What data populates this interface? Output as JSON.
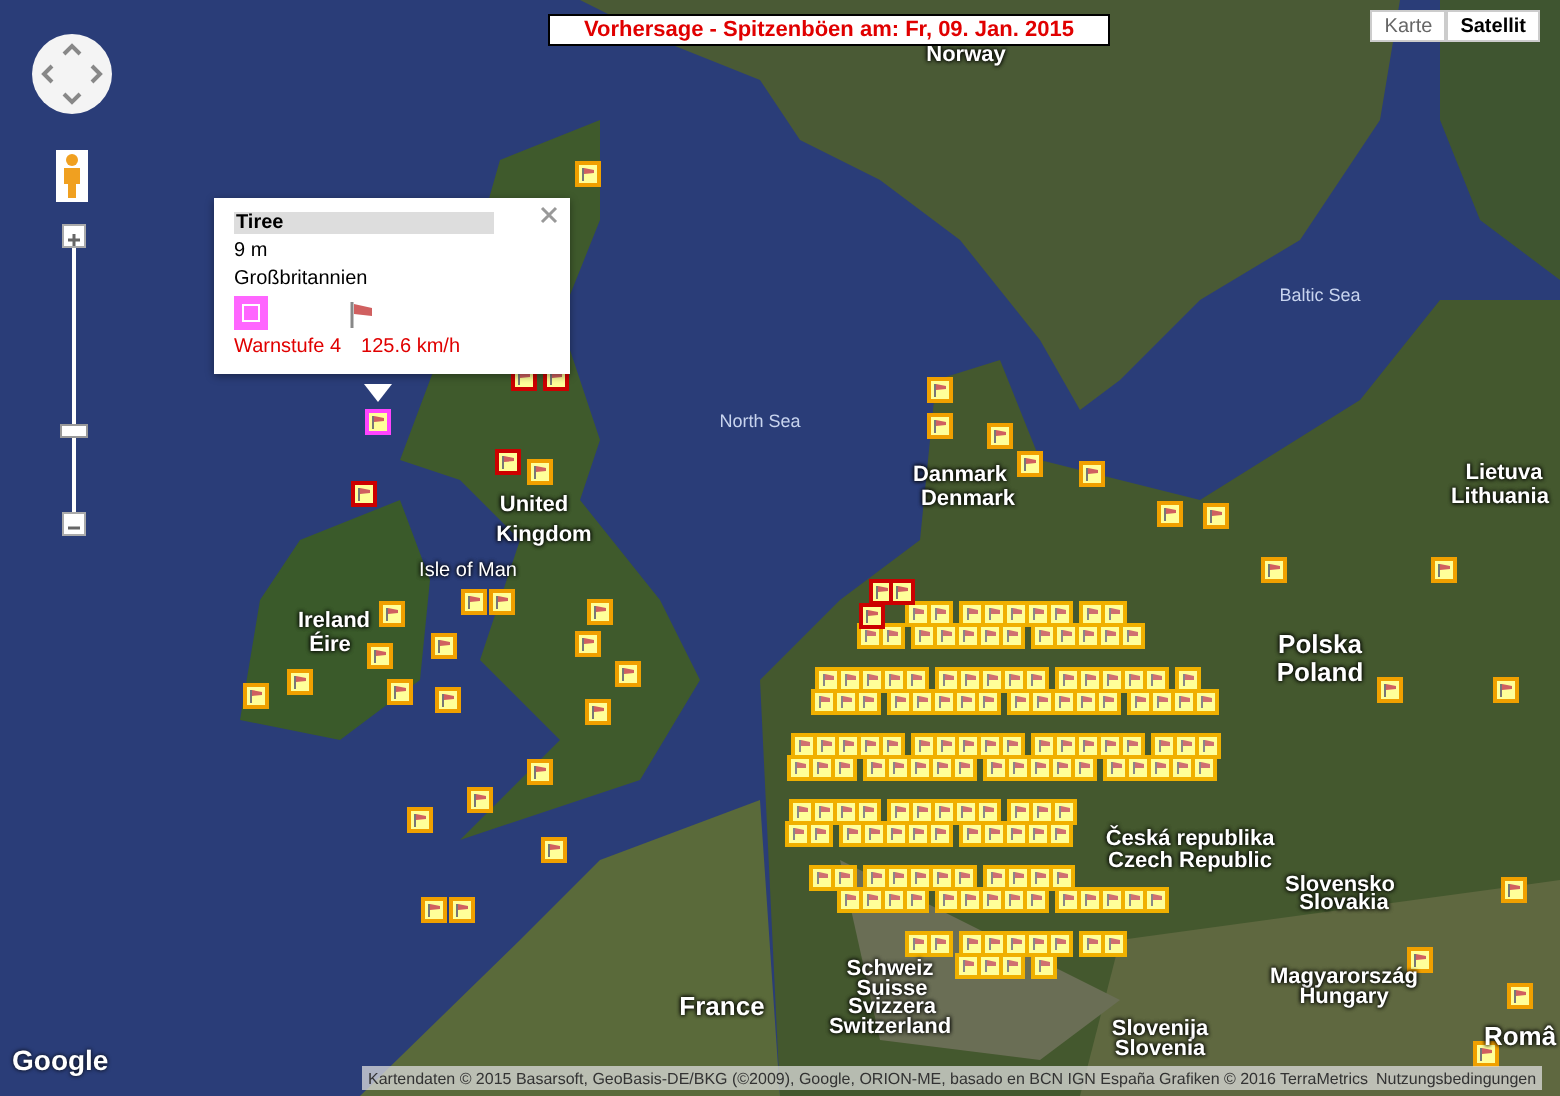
{
  "title_bar": {
    "text": "Vorhersage - Spitzenböen am: Fr, 09. Jan. 2015"
  },
  "map_types": [
    {
      "label": "Karte",
      "selected": false
    },
    {
      "label": "Satellit",
      "selected": true
    }
  ],
  "zoom": {
    "level": 0.31
  },
  "map_labels": [
    {
      "text": "Norway",
      "kind": "country"
    },
    {
      "text": "Baltic Sea",
      "kind": "sea"
    },
    {
      "text": "North Sea",
      "kind": "sea"
    },
    {
      "text": "Danmark",
      "kind": "country"
    },
    {
      "text": "Lietuva",
      "kind": "country"
    },
    {
      "text": "United",
      "kind": "country"
    },
    {
      "text": "Denmark",
      "kind": "country"
    },
    {
      "text": "Lithuania",
      "kind": "country"
    },
    {
      "text": "Kingdom",
      "kind": "country"
    },
    {
      "text": "Isle of Man",
      "kind": "small"
    },
    {
      "text": "Ireland",
      "kind": "country"
    },
    {
      "text": "Éire",
      "kind": "country"
    },
    {
      "text": "Polska",
      "kind": "big"
    },
    {
      "text": "Poland",
      "kind": "big"
    },
    {
      "text": "Česká republika",
      "kind": "country"
    },
    {
      "text": "Czech Republic",
      "kind": "country"
    },
    {
      "text": "Slovensko",
      "kind": "country"
    },
    {
      "text": "Slovakia",
      "kind": "country"
    },
    {
      "text": "Schweiz",
      "kind": "country"
    },
    {
      "text": "Suisse",
      "kind": "country"
    },
    {
      "text": "Svizzera",
      "kind": "country"
    },
    {
      "text": "Switzerland",
      "kind": "country"
    },
    {
      "text": "Magyarország",
      "kind": "country"
    },
    {
      "text": "Hungary",
      "kind": "country"
    },
    {
      "text": "France",
      "kind": "big"
    },
    {
      "text": "Slovenija",
      "kind": "country"
    },
    {
      "text": "Slovenia",
      "kind": "country"
    },
    {
      "text": "Româ",
      "kind": "big"
    }
  ],
  "markers": [
    {
      "color": "#f0a000"
    },
    {
      "color": "#cc0000"
    },
    {
      "color": "#cc0000"
    },
    {
      "color": "#cc0000"
    },
    {
      "color": "#cc0000"
    },
    {
      "color": "#f0a000"
    },
    {
      "color": "#f0a000"
    },
    {
      "color": "#f0a000"
    },
    {
      "color": "#f0a000"
    },
    {
      "color": "#f0a000"
    },
    {
      "color": "#f0a000"
    },
    {
      "color": "#f0a000"
    },
    {
      "color": "#f0a000"
    },
    {
      "color": "#f0a000"
    },
    {
      "color": "#f0a000"
    },
    {
      "color": "#f0a000"
    },
    {
      "color": "#f0a000"
    },
    {
      "color": "#f0a000"
    },
    {
      "color": "#f0a000"
    },
    {
      "color": "#f0a000"
    },
    {
      "color": "#f0a000"
    },
    {
      "color": "#f0a000"
    },
    {
      "color": "#f0a000"
    },
    {
      "color": "#f0a000"
    },
    {
      "color": "#f0a000"
    },
    {
      "color": "#f0a000"
    },
    {
      "color": "#f0a000"
    },
    {
      "color": "#f0a000"
    },
    {
      "color": "#f0a000"
    },
    {
      "color": "#f0a000"
    },
    {
      "color": "#f0a000"
    },
    {
      "color": "#f0a000"
    },
    {
      "color": "#f0a000"
    },
    {
      "color": "#f0a000"
    },
    {
      "color": "#f0a000"
    },
    {
      "color": "#f0a000"
    },
    {
      "color": "#f0a000"
    },
    {
      "color": "#f0a000"
    },
    {
      "color": "#f0a000"
    },
    {
      "color": "#f0a000"
    },
    {
      "color": "#cc0000"
    },
    {
      "color": "#cc0000"
    },
    {
      "color": "#cc0000"
    },
    {
      "color": "#ff44ff"
    }
  ],
  "popup": {
    "title": "Tiree",
    "elevation": "9 m",
    "country": "Großbritannien",
    "color": "#ff66ff",
    "warning": "Warnstufe 4",
    "speed": "125.6 km/h"
  },
  "logo": {
    "text": "Google"
  },
  "attribution": {
    "text": "Kartendaten © 2015 Basarsoft, GeoBasis-DE/BKG (©2009), Google, ORION-ME, basado en BCN IGN España Grafiken © 2016 TerraMetrics",
    "terms_link": "Nutzungsbedingungen"
  }
}
